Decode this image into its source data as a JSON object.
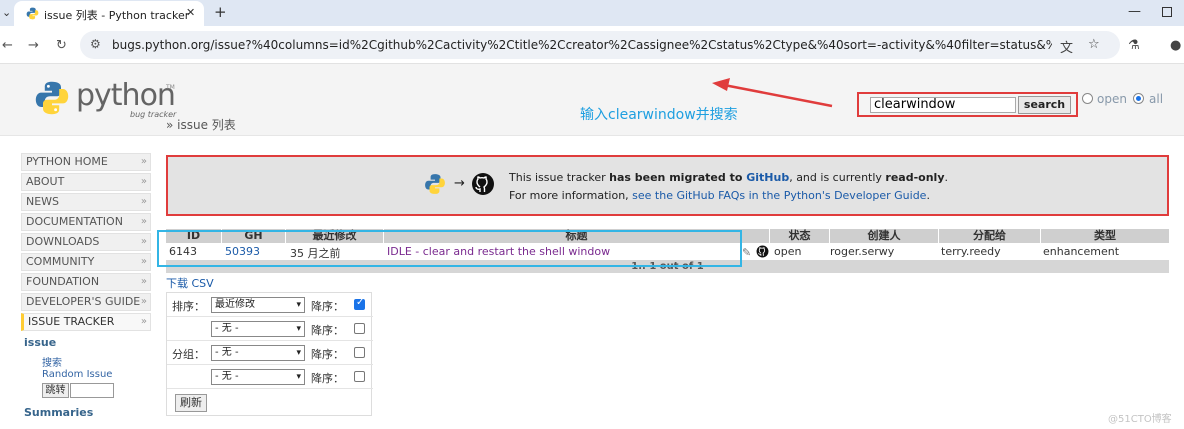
{
  "browser": {
    "tab_title": "issue 列表 - Python tracker",
    "url": "bugs.python.org/issue?%40columns=id%2Cgithub%2Cactivity%2Ctitle%2Ccreator%2Cassignee%2Cstatus%2Ctype&%40sort=-activity&%40filter=status&%40action=searc..."
  },
  "header": {
    "logo_text": "python",
    "logo_tm": "TM",
    "logo_sub": "bug tracker",
    "breadcrumb": "» issue 列表",
    "annotation": "输入clearwindow并搜索",
    "search_value": "clearwindow",
    "search_button": "search",
    "radio_open": "open",
    "radio_all": "all"
  },
  "menu": {
    "items": [
      "PYTHON HOME",
      "ABOUT",
      "NEWS",
      "DOCUMENTATION",
      "DOWNLOADS",
      "COMMUNITY",
      "FOUNDATION",
      "DEVELOPER'S GUIDE",
      "ISSUE TRACKER"
    ],
    "section_issue": "issue",
    "link_search": "搜索",
    "link_random": "Random Issue",
    "jump_button": "跳转",
    "section_summaries": "Summaries"
  },
  "notice": {
    "line1_a": "This issue tracker ",
    "line1_b": "has been migrated to ",
    "line1_c": "GitHub",
    "line1_d": ", and is currently ",
    "line1_e": "read-only",
    "line1_f": ".",
    "line2_a": "For more information, ",
    "line2_b": "see the GitHub FAQs in the Python's Developer Guide",
    "line2_c": "."
  },
  "table": {
    "headers": [
      "ID",
      "GH",
      "最近修改",
      "标题",
      "状态",
      "创建人",
      "分配给",
      "类型"
    ],
    "row": {
      "id": "6143",
      "gh": "50393",
      "activity": "35 月之前",
      "title": "IDLE - clear and restart the shell window",
      "status": "open",
      "creator": "roger.serwy",
      "assignee": "terry.reedy",
      "type": "enhancement"
    },
    "pagination": "1.. 1 out of 1"
  },
  "csv_link": "下载 CSV",
  "form": {
    "sort_label": "排序：",
    "group_label": "分组：",
    "desc_label": "降序：",
    "sort1": "最近修改",
    "sort2": "- 无 -",
    "group1": "- 无 -",
    "group2": "- 无 -",
    "refresh": "刷新"
  },
  "watermark": "@51CTO博客",
  "colors": {
    "annotation": "#1e9fe0",
    "highlight_red": "#e03c3c",
    "highlight_cyan": "#33b5e5",
    "link": "#1a5aa8"
  }
}
